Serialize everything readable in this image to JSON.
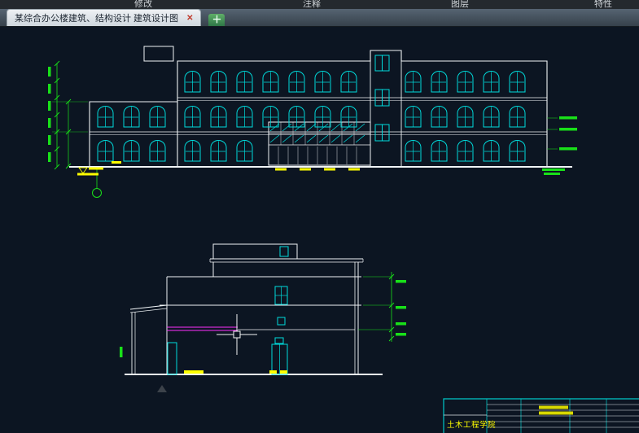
{
  "ribbon": {
    "items": [
      "修改",
      "注释",
      "图层",
      "特性"
    ]
  },
  "tab_bar": {
    "active_tab": "某综合办公楼建筑、结构设计 建筑设计图",
    "close_glyph": "✕",
    "new_tab_glyph": "＋"
  },
  "canvas": {
    "background_color": "#0c1522",
    "line_colors": {
      "outline": "#f0f4f6",
      "glazing": "#00dcdc",
      "dimension": "#19e019",
      "annotation": "#ffff00",
      "slab_line": "#ff30ff",
      "title_block": "#00c8c8"
    },
    "title_block": {
      "department": "土木工程学院"
    }
  }
}
